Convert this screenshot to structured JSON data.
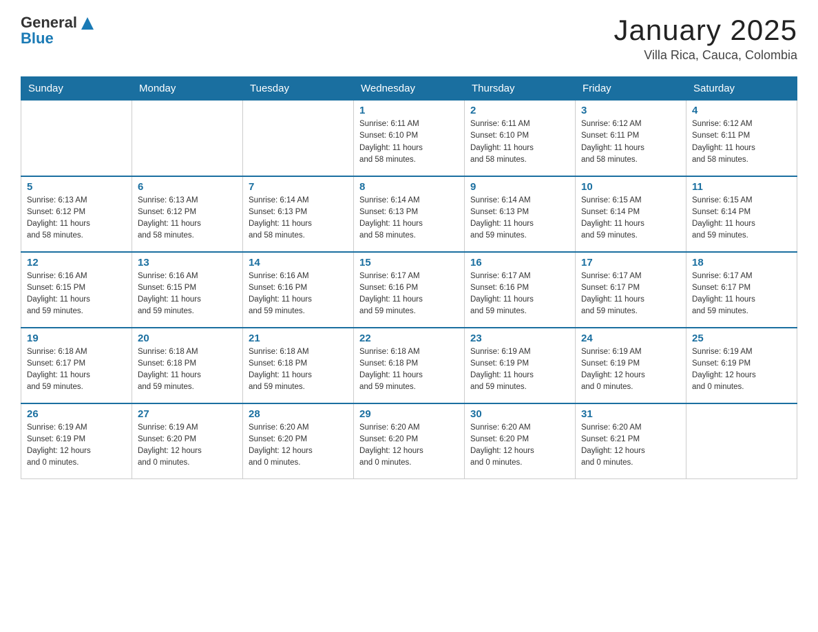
{
  "header": {
    "logo": {
      "general": "General",
      "blue": "Blue"
    },
    "title": "January 2025",
    "subtitle": "Villa Rica, Cauca, Colombia"
  },
  "weekdays": [
    "Sunday",
    "Monday",
    "Tuesday",
    "Wednesday",
    "Thursday",
    "Friday",
    "Saturday"
  ],
  "weeks": [
    [
      {
        "day": "",
        "info": ""
      },
      {
        "day": "",
        "info": ""
      },
      {
        "day": "",
        "info": ""
      },
      {
        "day": "1",
        "info": "Sunrise: 6:11 AM\nSunset: 6:10 PM\nDaylight: 11 hours\nand 58 minutes."
      },
      {
        "day": "2",
        "info": "Sunrise: 6:11 AM\nSunset: 6:10 PM\nDaylight: 11 hours\nand 58 minutes."
      },
      {
        "day": "3",
        "info": "Sunrise: 6:12 AM\nSunset: 6:11 PM\nDaylight: 11 hours\nand 58 minutes."
      },
      {
        "day": "4",
        "info": "Sunrise: 6:12 AM\nSunset: 6:11 PM\nDaylight: 11 hours\nand 58 minutes."
      }
    ],
    [
      {
        "day": "5",
        "info": "Sunrise: 6:13 AM\nSunset: 6:12 PM\nDaylight: 11 hours\nand 58 minutes."
      },
      {
        "day": "6",
        "info": "Sunrise: 6:13 AM\nSunset: 6:12 PM\nDaylight: 11 hours\nand 58 minutes."
      },
      {
        "day": "7",
        "info": "Sunrise: 6:14 AM\nSunset: 6:13 PM\nDaylight: 11 hours\nand 58 minutes."
      },
      {
        "day": "8",
        "info": "Sunrise: 6:14 AM\nSunset: 6:13 PM\nDaylight: 11 hours\nand 58 minutes."
      },
      {
        "day": "9",
        "info": "Sunrise: 6:14 AM\nSunset: 6:13 PM\nDaylight: 11 hours\nand 59 minutes."
      },
      {
        "day": "10",
        "info": "Sunrise: 6:15 AM\nSunset: 6:14 PM\nDaylight: 11 hours\nand 59 minutes."
      },
      {
        "day": "11",
        "info": "Sunrise: 6:15 AM\nSunset: 6:14 PM\nDaylight: 11 hours\nand 59 minutes."
      }
    ],
    [
      {
        "day": "12",
        "info": "Sunrise: 6:16 AM\nSunset: 6:15 PM\nDaylight: 11 hours\nand 59 minutes."
      },
      {
        "day": "13",
        "info": "Sunrise: 6:16 AM\nSunset: 6:15 PM\nDaylight: 11 hours\nand 59 minutes."
      },
      {
        "day": "14",
        "info": "Sunrise: 6:16 AM\nSunset: 6:16 PM\nDaylight: 11 hours\nand 59 minutes."
      },
      {
        "day": "15",
        "info": "Sunrise: 6:17 AM\nSunset: 6:16 PM\nDaylight: 11 hours\nand 59 minutes."
      },
      {
        "day": "16",
        "info": "Sunrise: 6:17 AM\nSunset: 6:16 PM\nDaylight: 11 hours\nand 59 minutes."
      },
      {
        "day": "17",
        "info": "Sunrise: 6:17 AM\nSunset: 6:17 PM\nDaylight: 11 hours\nand 59 minutes."
      },
      {
        "day": "18",
        "info": "Sunrise: 6:17 AM\nSunset: 6:17 PM\nDaylight: 11 hours\nand 59 minutes."
      }
    ],
    [
      {
        "day": "19",
        "info": "Sunrise: 6:18 AM\nSunset: 6:17 PM\nDaylight: 11 hours\nand 59 minutes."
      },
      {
        "day": "20",
        "info": "Sunrise: 6:18 AM\nSunset: 6:18 PM\nDaylight: 11 hours\nand 59 minutes."
      },
      {
        "day": "21",
        "info": "Sunrise: 6:18 AM\nSunset: 6:18 PM\nDaylight: 11 hours\nand 59 minutes."
      },
      {
        "day": "22",
        "info": "Sunrise: 6:18 AM\nSunset: 6:18 PM\nDaylight: 11 hours\nand 59 minutes."
      },
      {
        "day": "23",
        "info": "Sunrise: 6:19 AM\nSunset: 6:19 PM\nDaylight: 11 hours\nand 59 minutes."
      },
      {
        "day": "24",
        "info": "Sunrise: 6:19 AM\nSunset: 6:19 PM\nDaylight: 12 hours\nand 0 minutes."
      },
      {
        "day": "25",
        "info": "Sunrise: 6:19 AM\nSunset: 6:19 PM\nDaylight: 12 hours\nand 0 minutes."
      }
    ],
    [
      {
        "day": "26",
        "info": "Sunrise: 6:19 AM\nSunset: 6:19 PM\nDaylight: 12 hours\nand 0 minutes."
      },
      {
        "day": "27",
        "info": "Sunrise: 6:19 AM\nSunset: 6:20 PM\nDaylight: 12 hours\nand 0 minutes."
      },
      {
        "day": "28",
        "info": "Sunrise: 6:20 AM\nSunset: 6:20 PM\nDaylight: 12 hours\nand 0 minutes."
      },
      {
        "day": "29",
        "info": "Sunrise: 6:20 AM\nSunset: 6:20 PM\nDaylight: 12 hours\nand 0 minutes."
      },
      {
        "day": "30",
        "info": "Sunrise: 6:20 AM\nSunset: 6:20 PM\nDaylight: 12 hours\nand 0 minutes."
      },
      {
        "day": "31",
        "info": "Sunrise: 6:20 AM\nSunset: 6:21 PM\nDaylight: 12 hours\nand 0 minutes."
      },
      {
        "day": "",
        "info": ""
      }
    ]
  ]
}
